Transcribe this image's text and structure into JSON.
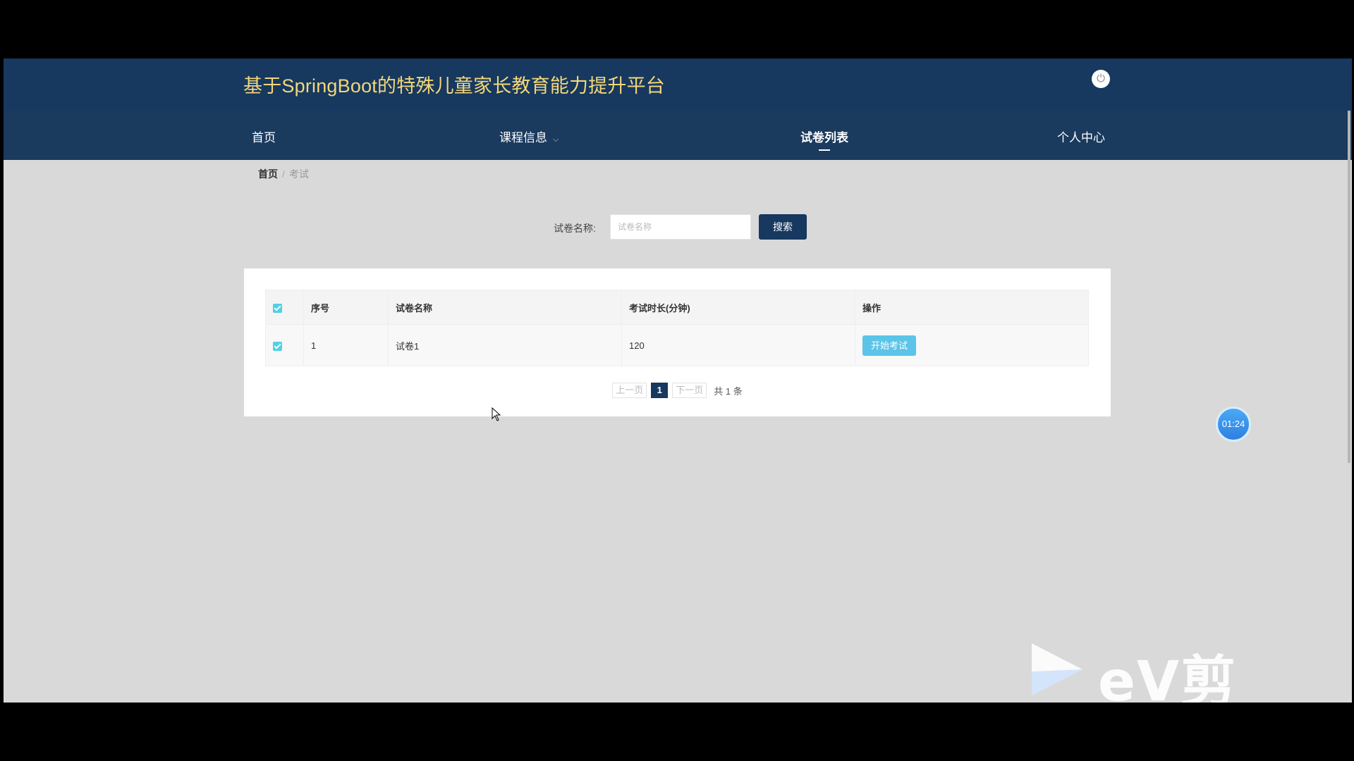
{
  "header": {
    "title": "基于SpringBoot的特殊儿童家长教育能力提升平台",
    "power_icon": "power-icon"
  },
  "nav": [
    {
      "label": "首页"
    },
    {
      "label": "课程信息"
    },
    {
      "label": "试卷列表"
    },
    {
      "label": "个人中心"
    }
  ],
  "breadcrumb": {
    "home": "首页",
    "separator": "/",
    "current": "考试"
  },
  "search": {
    "label": "试卷名称:",
    "placeholder": "试卷名称",
    "value": "",
    "button": "搜索"
  },
  "table": {
    "headers": [
      "序号",
      "试卷名称",
      "考试时长(分钟)",
      "操作"
    ],
    "rows": [
      {
        "index": "1",
        "name": "试卷1",
        "duration": "120",
        "action": "开始考试"
      }
    ]
  },
  "pagination": {
    "prev": "上一页",
    "current": "1",
    "next": "下一页",
    "total": "共 1 条"
  },
  "timer": "01:24",
  "watermark": "eV剪辑",
  "colors": {
    "header_bg": "#17385f",
    "title": "#f2d77a",
    "accent": "#5bc4e8",
    "checkbox": "#4fd1e6"
  }
}
